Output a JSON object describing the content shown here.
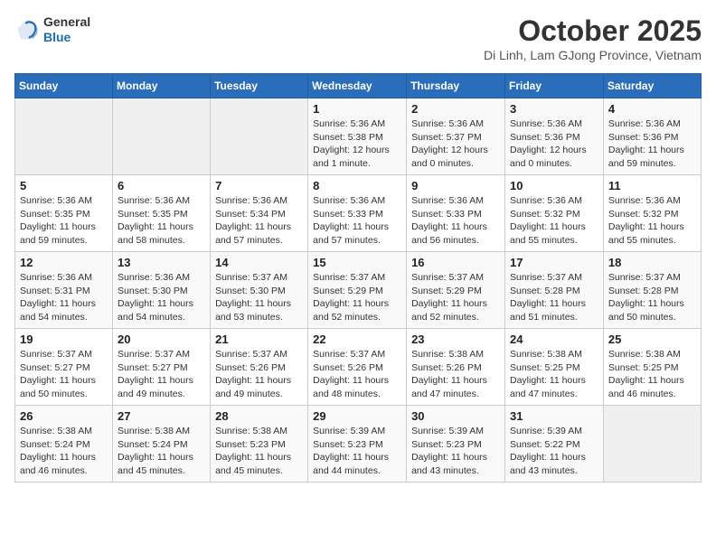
{
  "logo": {
    "general": "General",
    "blue": "Blue"
  },
  "header": {
    "title": "October 2025",
    "subtitle": "Di Linh, Lam GJong Province, Vietnam"
  },
  "weekdays": [
    "Sunday",
    "Monday",
    "Tuesday",
    "Wednesday",
    "Thursday",
    "Friday",
    "Saturday"
  ],
  "weeks": [
    [
      {
        "day": "",
        "info": ""
      },
      {
        "day": "",
        "info": ""
      },
      {
        "day": "",
        "info": ""
      },
      {
        "day": "1",
        "info": "Sunrise: 5:36 AM\nSunset: 5:38 PM\nDaylight: 12 hours\nand 1 minute."
      },
      {
        "day": "2",
        "info": "Sunrise: 5:36 AM\nSunset: 5:37 PM\nDaylight: 12 hours\nand 0 minutes."
      },
      {
        "day": "3",
        "info": "Sunrise: 5:36 AM\nSunset: 5:36 PM\nDaylight: 12 hours\nand 0 minutes."
      },
      {
        "day": "4",
        "info": "Sunrise: 5:36 AM\nSunset: 5:36 PM\nDaylight: 11 hours\nand 59 minutes."
      }
    ],
    [
      {
        "day": "5",
        "info": "Sunrise: 5:36 AM\nSunset: 5:35 PM\nDaylight: 11 hours\nand 59 minutes."
      },
      {
        "day": "6",
        "info": "Sunrise: 5:36 AM\nSunset: 5:35 PM\nDaylight: 11 hours\nand 58 minutes."
      },
      {
        "day": "7",
        "info": "Sunrise: 5:36 AM\nSunset: 5:34 PM\nDaylight: 11 hours\nand 57 minutes."
      },
      {
        "day": "8",
        "info": "Sunrise: 5:36 AM\nSunset: 5:33 PM\nDaylight: 11 hours\nand 57 minutes."
      },
      {
        "day": "9",
        "info": "Sunrise: 5:36 AM\nSunset: 5:33 PM\nDaylight: 11 hours\nand 56 minutes."
      },
      {
        "day": "10",
        "info": "Sunrise: 5:36 AM\nSunset: 5:32 PM\nDaylight: 11 hours\nand 55 minutes."
      },
      {
        "day": "11",
        "info": "Sunrise: 5:36 AM\nSunset: 5:32 PM\nDaylight: 11 hours\nand 55 minutes."
      }
    ],
    [
      {
        "day": "12",
        "info": "Sunrise: 5:36 AM\nSunset: 5:31 PM\nDaylight: 11 hours\nand 54 minutes."
      },
      {
        "day": "13",
        "info": "Sunrise: 5:36 AM\nSunset: 5:30 PM\nDaylight: 11 hours\nand 54 minutes."
      },
      {
        "day": "14",
        "info": "Sunrise: 5:37 AM\nSunset: 5:30 PM\nDaylight: 11 hours\nand 53 minutes."
      },
      {
        "day": "15",
        "info": "Sunrise: 5:37 AM\nSunset: 5:29 PM\nDaylight: 11 hours\nand 52 minutes."
      },
      {
        "day": "16",
        "info": "Sunrise: 5:37 AM\nSunset: 5:29 PM\nDaylight: 11 hours\nand 52 minutes."
      },
      {
        "day": "17",
        "info": "Sunrise: 5:37 AM\nSunset: 5:28 PM\nDaylight: 11 hours\nand 51 minutes."
      },
      {
        "day": "18",
        "info": "Sunrise: 5:37 AM\nSunset: 5:28 PM\nDaylight: 11 hours\nand 50 minutes."
      }
    ],
    [
      {
        "day": "19",
        "info": "Sunrise: 5:37 AM\nSunset: 5:27 PM\nDaylight: 11 hours\nand 50 minutes."
      },
      {
        "day": "20",
        "info": "Sunrise: 5:37 AM\nSunset: 5:27 PM\nDaylight: 11 hours\nand 49 minutes."
      },
      {
        "day": "21",
        "info": "Sunrise: 5:37 AM\nSunset: 5:26 PM\nDaylight: 11 hours\nand 49 minutes."
      },
      {
        "day": "22",
        "info": "Sunrise: 5:37 AM\nSunset: 5:26 PM\nDaylight: 11 hours\nand 48 minutes."
      },
      {
        "day": "23",
        "info": "Sunrise: 5:38 AM\nSunset: 5:26 PM\nDaylight: 11 hours\nand 47 minutes."
      },
      {
        "day": "24",
        "info": "Sunrise: 5:38 AM\nSunset: 5:25 PM\nDaylight: 11 hours\nand 47 minutes."
      },
      {
        "day": "25",
        "info": "Sunrise: 5:38 AM\nSunset: 5:25 PM\nDaylight: 11 hours\nand 46 minutes."
      }
    ],
    [
      {
        "day": "26",
        "info": "Sunrise: 5:38 AM\nSunset: 5:24 PM\nDaylight: 11 hours\nand 46 minutes."
      },
      {
        "day": "27",
        "info": "Sunrise: 5:38 AM\nSunset: 5:24 PM\nDaylight: 11 hours\nand 45 minutes."
      },
      {
        "day": "28",
        "info": "Sunrise: 5:38 AM\nSunset: 5:23 PM\nDaylight: 11 hours\nand 45 minutes."
      },
      {
        "day": "29",
        "info": "Sunrise: 5:39 AM\nSunset: 5:23 PM\nDaylight: 11 hours\nand 44 minutes."
      },
      {
        "day": "30",
        "info": "Sunrise: 5:39 AM\nSunset: 5:23 PM\nDaylight: 11 hours\nand 43 minutes."
      },
      {
        "day": "31",
        "info": "Sunrise: 5:39 AM\nSunset: 5:22 PM\nDaylight: 11 hours\nand 43 minutes."
      },
      {
        "day": "",
        "info": ""
      }
    ]
  ]
}
